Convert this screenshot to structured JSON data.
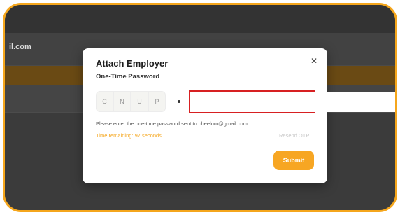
{
  "background": {
    "email_fragment": "il.com"
  },
  "modal": {
    "title": "Attach Employer",
    "subtitle": "One-Time Password",
    "close_icon": "close-icon",
    "otp_prefix": [
      "C",
      "N",
      "U",
      "P"
    ],
    "separator": "dot",
    "otp_inputs": [
      "",
      "",
      "",
      "",
      "",
      ""
    ],
    "info_text": "Please enter the one-time password sent to cheelom@gmail.com",
    "timer_text": "Time remaining: 97 seconds",
    "resend_label": "Resend OTP",
    "submit_label": "Submit"
  },
  "colors": {
    "accent": "#f5a61c",
    "highlight_border": "#d72022",
    "overlay": "#3d3d3d"
  }
}
